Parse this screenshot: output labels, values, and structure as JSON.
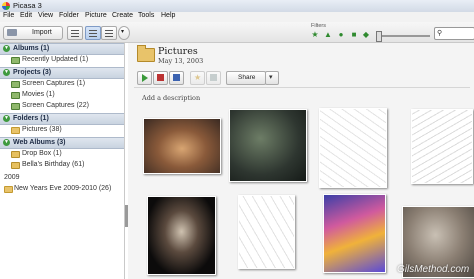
{
  "window": {
    "title": "Picasa 3"
  },
  "menu": [
    "File",
    "Edit",
    "View",
    "Folder",
    "Picture",
    "Create",
    "Tools",
    "Help"
  ],
  "toolbar": {
    "import_label": "Import",
    "filters_label": "Filters"
  },
  "sidebar": {
    "sections": [
      {
        "label": "Albums (1)",
        "items": [
          "Recently Updated (1)"
        ]
      },
      {
        "label": "Projects (3)",
        "items": [
          "Screen Captures (1)",
          "Movies (1)",
          "Screen Captures (22)"
        ]
      },
      {
        "label": "Folders (1)",
        "items": [
          "Pictures (38)"
        ]
      },
      {
        "label": "Web Albums (3)",
        "items": [
          "Drop Box (1)",
          "Bella's Birthday (61)"
        ]
      }
    ],
    "year_label": "2009",
    "year_items": [
      "New Years Eve 2009-2010 (26)"
    ]
  },
  "main": {
    "folder_title": "Pictures",
    "folder_date": "May 13, 2003",
    "share_label": "Share",
    "description_placeholder": "Add a description"
  },
  "icons": {
    "play": "play-icon",
    "filter_icons": [
      "star-icon",
      "upload-icon",
      "person-icon",
      "video-icon",
      "map-icon",
      "location-icon"
    ],
    "search": "magnifier-icon"
  },
  "colors": {
    "accent_green": "#3f9a3f",
    "section_head": "#c9d3e0"
  },
  "watermark": "GilsMethod.com"
}
